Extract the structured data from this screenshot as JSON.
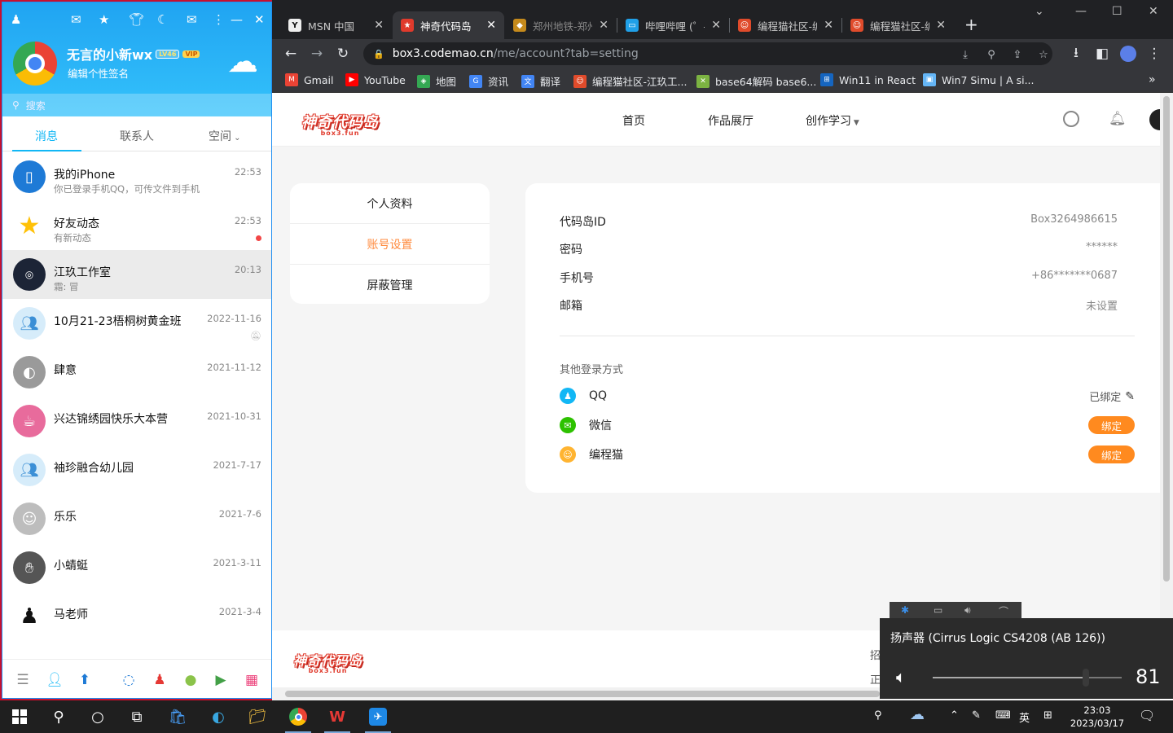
{
  "browser": {
    "tabs": [
      {
        "title": "MSN 中国",
        "icon_color": "#111111",
        "icon": "msn-icon"
      },
      {
        "title": "神奇代码岛",
        "icon_color": "#e03a2c",
        "icon": "codemao-island-icon",
        "active": true
      },
      {
        "title": "郑州地铁-郑州",
        "icon_color": "#c58a1c",
        "icon": "metro-icon"
      },
      {
        "title": "哔哩哔哩 (゜-",
        "icon_color": "#20a0e8",
        "icon": "bilibili-icon"
      },
      {
        "title": "编程猫社区-编",
        "icon_color": "#e04b2b",
        "icon": "codemao-icon"
      },
      {
        "title": "编程猫社区-编",
        "icon_color": "#e04b2b",
        "icon": "codemao-icon"
      }
    ],
    "url_host": "box3.codemao.cn",
    "url_path": "/me/account?tab=setting",
    "bookmarks": [
      {
        "label": "Gmail",
        "icon": "gmail-icon",
        "color": "#ea4335"
      },
      {
        "label": "YouTube",
        "icon": "youtube-icon",
        "color": "#ff0000"
      },
      {
        "label": "地图",
        "icon": "maps-icon",
        "color": "#34a853"
      },
      {
        "label": "资讯",
        "icon": "news-icon",
        "color": "#4285f4"
      },
      {
        "label": "翻译",
        "icon": "translate-icon",
        "color": "#4285f4"
      },
      {
        "label": "编程猫社区-江玖工...",
        "icon": "codemao-icon",
        "color": "#e04b2b"
      },
      {
        "label": "base64解码 base6...",
        "icon": "base64-icon",
        "color": "#7cb342"
      },
      {
        "label": "Win11 in React",
        "icon": "win11-icon",
        "color": "#1565c0"
      },
      {
        "label": "Win7 Simu | A si...",
        "icon": "win7-icon",
        "color": "#64b5f6"
      }
    ]
  },
  "site": {
    "logo_text": "神奇代码岛",
    "logo_sub": "box3.fun",
    "nav": [
      "首页",
      "作品展厅",
      "创作学习"
    ],
    "menu": [
      "个人资料",
      "账号设置",
      "屏蔽管理"
    ],
    "account": [
      {
        "label": "代码岛ID",
        "value": "Box3264986615"
      },
      {
        "label": "密码",
        "value": "******"
      },
      {
        "label": "手机号",
        "value": "+86*******0687"
      },
      {
        "label": "邮箱",
        "value": "未设置"
      }
    ],
    "other_login_title": "其他登录方式",
    "logins": [
      {
        "name": "QQ",
        "status": "已绑定",
        "color": "#12b7f5"
      },
      {
        "name": "微信",
        "action": "绑定",
        "color": "#2dc100"
      },
      {
        "name": "编程猫",
        "action": "绑定",
        "color": "#ffb431"
      }
    ],
    "footer_cut1": "招",
    "footer_cut2": "正"
  },
  "qq": {
    "nickname": "无言的小新wx",
    "level_badge": "LV46",
    "vip_badge": "VIP",
    "signature": "编辑个性签名",
    "search_placeholder": "搜索",
    "tabs": [
      "消息",
      "联系人",
      "空间"
    ],
    "conversations": [
      {
        "name": "我的iPhone",
        "preview": "你已登录手机QQ，可传文件到手机",
        "time": "22:53",
        "avatar_color": "#1e7ad6",
        "avatar_icon": "phone-icon"
      },
      {
        "name": "好友动态",
        "preview": "有新动态",
        "time": "22:53",
        "avatar_color": "#ffd21f",
        "avatar_icon": "star-icon",
        "unread": true
      },
      {
        "name": "江玖工作室",
        "preview": "霜: 冒",
        "time": "20:13",
        "avatar_color": "#1c2436",
        "avatar_icon": "studio-logo-icon",
        "highlight": true
      },
      {
        "name": "10月21-23梧桐树黄金班",
        "preview": "",
        "time": "2022-11-16",
        "avatar_color": "#7ab8e8",
        "avatar_icon": "group-icon",
        "muted": true
      },
      {
        "name": "肆意",
        "preview": "",
        "time": "2021-11-12",
        "avatar_color": "#9a9a9a",
        "avatar_icon": "user-photo-icon"
      },
      {
        "name": "兴达锦绣园快乐大本营",
        "preview": "",
        "time": "2021-10-31",
        "avatar_color": "#e86b9c",
        "avatar_icon": "cup-icon"
      },
      {
        "name": "袖珍融合幼儿园",
        "preview": "",
        "time": "2021-7-17",
        "avatar_color": "#7ab8e8",
        "avatar_icon": "group-icon"
      },
      {
        "name": "乐乐",
        "preview": "",
        "time": "2021-7-6",
        "avatar_color": "#bdbdbd",
        "avatar_icon": "anime-avatar-icon"
      },
      {
        "name": "小蜻蜓",
        "preview": "",
        "time": "2021-3-11",
        "avatar_color": "#555555",
        "avatar_icon": "hands-photo-icon"
      },
      {
        "name": "马老师",
        "preview": "",
        "time": "2021-3-4",
        "avatar_color": "#ffffff",
        "avatar_icon": "penguin-icon"
      }
    ]
  },
  "volume": {
    "device": "扬声器 (Cirrus Logic CS4208 (AB 126))",
    "level": 81
  },
  "taskbar": {
    "ime": "英",
    "time": "23:03",
    "date": "2023/03/17"
  }
}
